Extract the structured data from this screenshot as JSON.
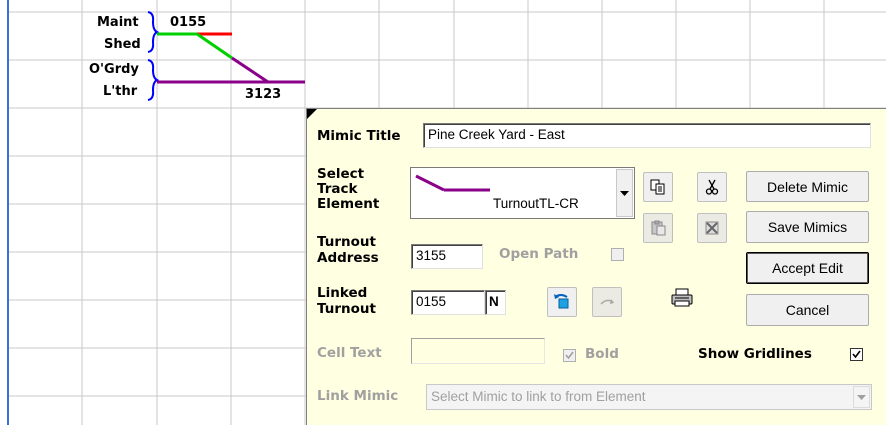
{
  "grid_cells": {
    "maint": "Maint",
    "shed": "Shed",
    "ogrdy": "O'Grdy",
    "lthr": "L'thr",
    "turnout_top": "0155",
    "turnout_bottom": "3123"
  },
  "colors": {
    "grid_line": "#c8c8c8",
    "track_purple": "#8b008b",
    "track_green": "#00d000",
    "track_red": "#ff0000",
    "bracket_blue": "#0000ff",
    "dialog_bg": "#ffffe1"
  },
  "dialog": {
    "mimic_title_label": "Mimic Title",
    "mimic_title_value": "Pine Creek Yard - East",
    "select_element_label_1": "Select",
    "select_element_label_2": "Track",
    "select_element_label_3": "Element",
    "selected_element": "TurnoutTL-CR",
    "turnout_address_label_1": "Turnout",
    "turnout_address_label_2": "Address",
    "turnout_address_value": "3155",
    "open_path_label": "Open Path",
    "linked_turnout_label_1": "Linked",
    "linked_turnout_label_2": "Turnout",
    "linked_turnout_value": "0155",
    "linked_turnout_state": "N",
    "cell_text_label": "Cell Text",
    "cell_text_value": "",
    "bold_label": "Bold",
    "show_gridlines_label": "Show Gridlines",
    "link_mimic_label": "Link Mimic",
    "link_mimic_placeholder": "Select Mimic to link to from Element",
    "buttons": {
      "delete": "Delete Mimic",
      "save": "Save Mimics",
      "accept": "Accept Edit",
      "cancel": "Cancel"
    },
    "icons": {
      "copy": "copy-icon",
      "cut": "cut-icon",
      "paste": "paste-icon",
      "delete_cells": "delete-cells-icon",
      "undo": "undo-icon",
      "redo": "redo-icon",
      "print": "printer-icon"
    }
  }
}
